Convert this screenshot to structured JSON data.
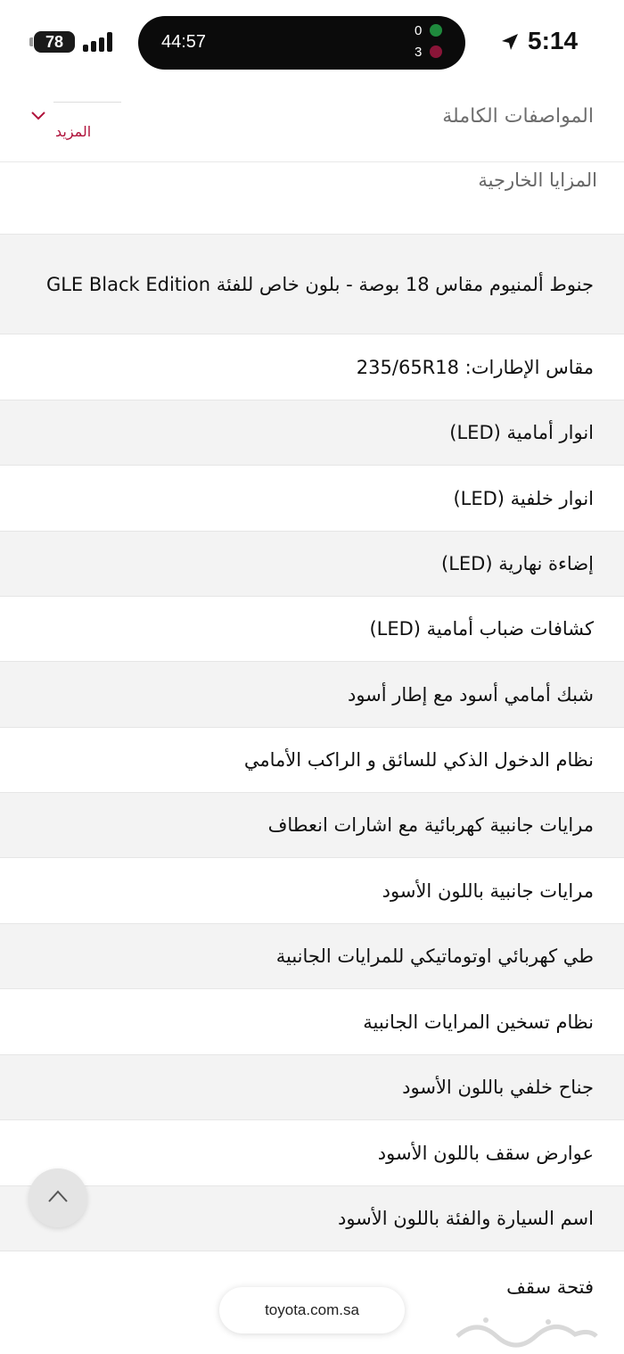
{
  "status": {
    "battery": "78",
    "timer": "44:57",
    "score_home": "0",
    "score_away": "3",
    "time": "5:14"
  },
  "header": {
    "title": "المواصفات الكاملة",
    "more_label": "المزيد"
  },
  "section": {
    "title": "المزايا الخارجية"
  },
  "features": [
    {
      "label": "جنوط ألمنيوم مقاس 18 بوصة - بلون خاص للفئة GLE Black Edition",
      "shade": true
    },
    {
      "label": "مقاس الإطارات: 235/65R18",
      "shade": false
    },
    {
      "label": "انوار أمامية (LED)",
      "shade": true
    },
    {
      "label": "انوار خلفية (LED)",
      "shade": false
    },
    {
      "label": "إضاءة نهارية (LED)",
      "shade": true
    },
    {
      "label": "كشافات ضباب أمامية (LED)",
      "shade": false
    },
    {
      "label": "شبك أمامي أسود مع إطار أسود",
      "shade": true
    },
    {
      "label": "نظام الدخول الذكي للسائق و الراكب الأمامي",
      "shade": false
    },
    {
      "label": "مرايات جانبية كهربائية مع اشارات انعطاف",
      "shade": true
    },
    {
      "label": "مرايات جانبية باللون الأسود",
      "shade": false
    },
    {
      "label": "طي كهربائي اوتوماتيكي للمرايات الجانبية",
      "shade": true
    },
    {
      "label": "نظام تسخين المرايات الجانبية",
      "shade": false
    },
    {
      "label": "جناح خلفي باللون الأسود",
      "shade": true
    },
    {
      "label": "عوارض سقف باللون الأسود",
      "shade": false
    },
    {
      "label": "اسم السيارة والفئة باللون الأسود",
      "shade": true
    },
    {
      "label": "فتحة سقف",
      "shade": false
    }
  ],
  "browser": {
    "url": "toyota.com.sa"
  },
  "colors": {
    "accent": "#b0123b",
    "row_shade": "#f3f3f3"
  },
  "icons": {
    "more": "chevron-down-icon",
    "scroll_top": "chevron-up-icon",
    "location": "location-arrow-icon"
  }
}
